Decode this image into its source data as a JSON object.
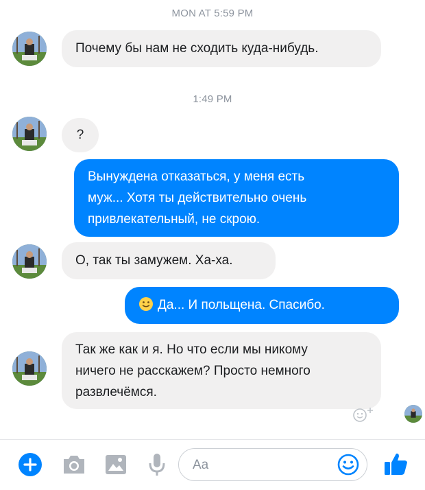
{
  "conversation": {
    "timestamps": [
      "MON AT 5:59 PM",
      "1:49 PM"
    ],
    "messages": [
      {
        "from": "them",
        "lines": [
          "Почему бы нам не сходить куда-нибудь."
        ]
      },
      {
        "from": "them",
        "lines": [
          "?"
        ]
      },
      {
        "from": "me",
        "lines": [
          "Вынуждена отказаться, у меня есть",
          "муж... Хотя ты действительно очень",
          "привлекательный, не скрою."
        ]
      },
      {
        "from": "them",
        "lines": [
          "О, так ты замужем. Ха-ха."
        ]
      },
      {
        "from": "me",
        "emoji": "slight-smile",
        "lines": [
          "Да... И польщена. Спасибо."
        ]
      },
      {
        "from": "them",
        "lines": [
          "Так же как и я. Но что если мы никому",
          "ничего не расскажем? Просто немного",
          "развлечёмся."
        ]
      }
    ]
  },
  "composer": {
    "placeholder": "Aa",
    "icons": [
      "plus-icon",
      "camera-icon",
      "image-icon",
      "microphone-icon",
      "emoji-icon",
      "thumbs-up-icon"
    ]
  },
  "colors": {
    "accent": "#0084ff",
    "incoming_bubble": "#f1f0f0",
    "timestamp": "#8d949e"
  }
}
